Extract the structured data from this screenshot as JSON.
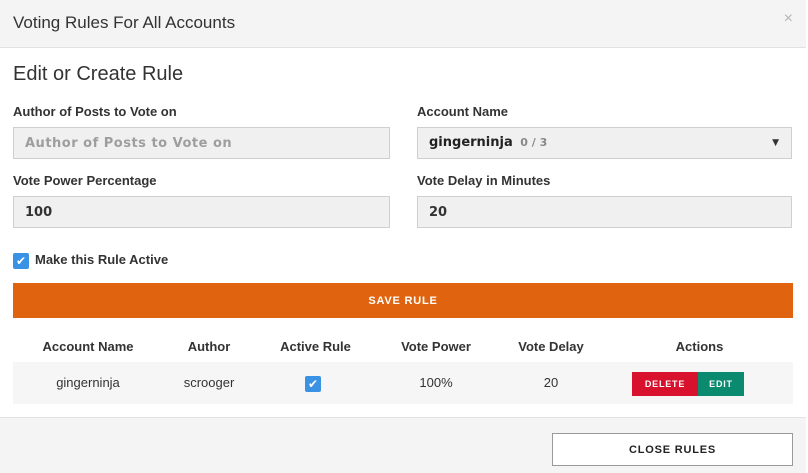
{
  "modal": {
    "title": "Voting Rules For All Accounts",
    "close_glyph": "×"
  },
  "form": {
    "title": "Edit or Create Rule",
    "author_label": "Author of Posts to Vote on",
    "author_placeholder": "Author of Posts to Vote on",
    "author_value": "",
    "account_label": "Account Name",
    "account_selected": "gingerninja",
    "account_count": "0 / 3",
    "vote_power_label": "Vote Power Percentage",
    "vote_power_value": "100",
    "vote_delay_label": "Vote Delay in Minutes",
    "vote_delay_value": "20",
    "active_label": "Make this Rule Active",
    "active_checked": true,
    "save_label": "SAVE RULE"
  },
  "table": {
    "headers": [
      "Account Name",
      "Author",
      "Active Rule",
      "Vote Power",
      "Vote Delay",
      "Actions"
    ],
    "rows": [
      {
        "account": "gingerninja",
        "author": "scrooger",
        "active": true,
        "vote_power": "100%",
        "vote_delay": "20",
        "delete_label": "DELETE",
        "edit_label": "EDIT"
      }
    ]
  },
  "footer": {
    "close_label": "CLOSE RULES"
  },
  "colors": {
    "accent": "#e0640f",
    "checkbox": "#3a92e5",
    "delete": "#d8122d",
    "edit": "#0c8a6f"
  }
}
